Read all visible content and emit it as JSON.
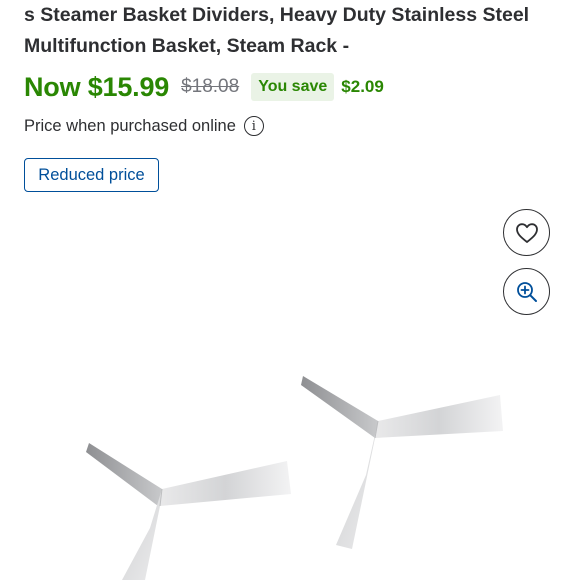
{
  "product": {
    "title": "s Steamer Basket Dividers, Heavy Duty Stainless Steel Multifunction Basket, Steam Rack -"
  },
  "pricing": {
    "now_price": "Now $15.99",
    "was_price": "$18.08",
    "you_save_label": "You save",
    "save_amount": "$2.09",
    "price_note": "Price when purchased online",
    "reduced_badge": "Reduced price"
  },
  "icons": {
    "info": "info-icon",
    "favorite": "heart-icon",
    "zoom": "zoom-in-icon"
  },
  "colors": {
    "price_green": "#2a8703",
    "save_badge_bg": "#eaf3e6",
    "badge_blue": "#004f9a",
    "text": "#2e2f32",
    "strike_gray": "#74767c"
  }
}
